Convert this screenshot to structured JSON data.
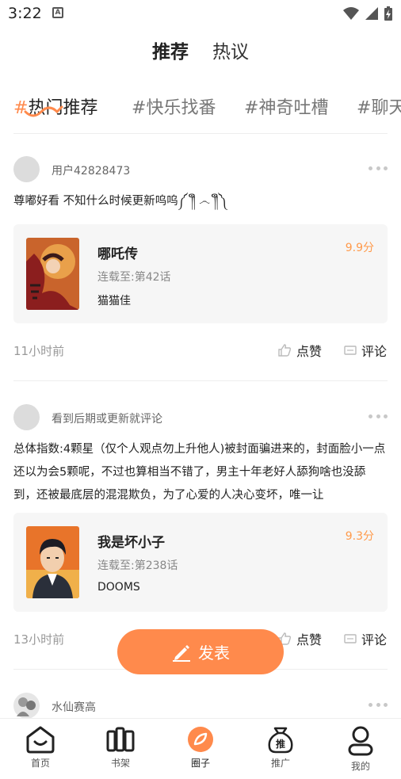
{
  "status_bar": {
    "time": "3:22",
    "notification_glyph": "A"
  },
  "top_tabs": [
    {
      "label": "推荐",
      "active": true
    },
    {
      "label": "热议",
      "active": false
    }
  ],
  "topics": [
    {
      "hash": "#",
      "label": "热门推荐",
      "active": true
    },
    {
      "hash": "#",
      "label": "快乐找番",
      "active": false
    },
    {
      "hash": "#",
      "label": "神奇吐槽",
      "active": false
    },
    {
      "hash": "#",
      "label": "聊天",
      "active": false
    }
  ],
  "posts": [
    {
      "username": "用户42828473",
      "text": "尊嘟好看 不知什么时候更新呜呜༼ ༎ຶ ෴ ༎ຶ༽",
      "card": {
        "title": "哪吒传",
        "progress": "连载至:第42话",
        "author": "猫猫佳",
        "score": "9.9分"
      },
      "time": "11小时前",
      "like_label": "点赞",
      "comment_label": "评论"
    },
    {
      "username": "看到后期或更新就评论",
      "text": "总体指数:4颗星（仅个人观点勿上升他人)被封面骗进来的，封面脸小一点还以为会5颗呢，不过也算相当不错了，男主十年老好人舔狗啥也没舔到，还被最底层的混混欺负，为了心爱的人决心变坏，唯一让",
      "card": {
        "title": "我是坏小子",
        "progress": "连载至:第238话",
        "author": "DOOMS",
        "score": "9.3分"
      },
      "time": "13小时前",
      "like_label": "点赞",
      "comment_label": "评论"
    },
    {
      "username": "水仙赛高"
    }
  ],
  "publish_button": {
    "label": "发表"
  },
  "bottom_nav": [
    {
      "label": "首页",
      "icon": "home-icon"
    },
    {
      "label": "书架",
      "icon": "bookshelf-icon"
    },
    {
      "label": "圈子",
      "icon": "circle-icon",
      "active": true
    },
    {
      "label": "推广",
      "icon": "promote-bag-icon",
      "badge": "推"
    },
    {
      "label": "我的",
      "icon": "profile-icon"
    }
  ],
  "colors": {
    "accent": "#ff8a4c",
    "score": "#ff9a4a",
    "card_bg": "#f6f6f6"
  }
}
